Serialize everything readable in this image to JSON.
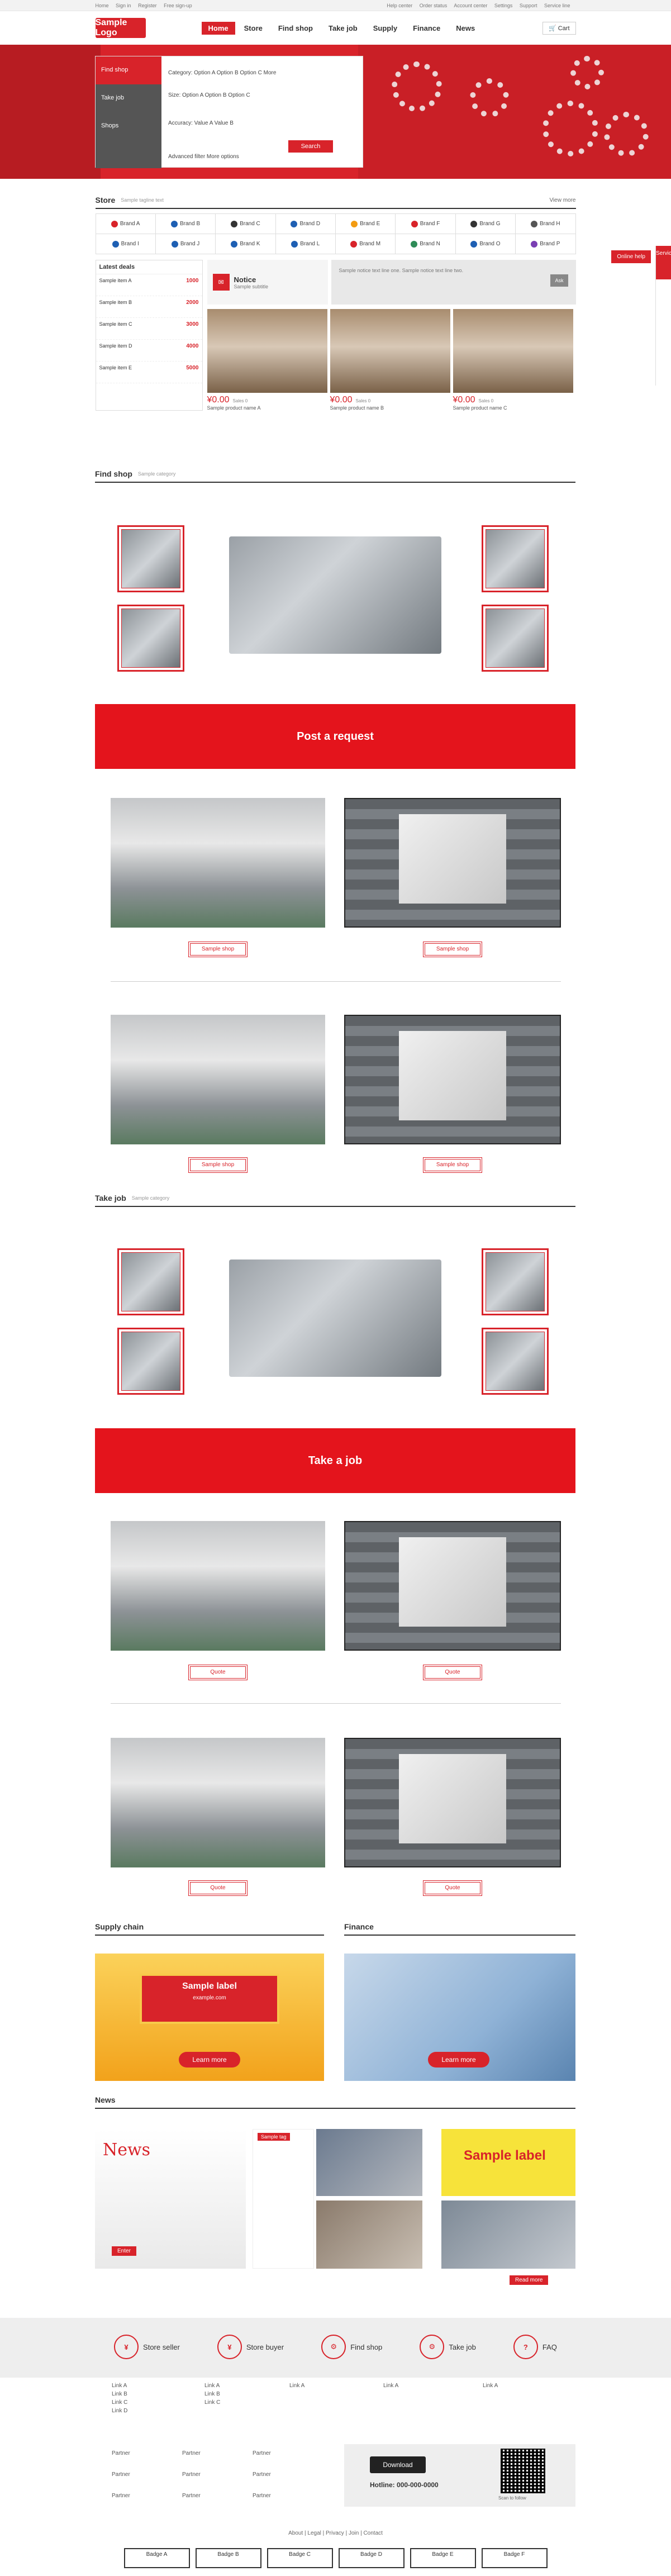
{
  "topbar": {
    "left": [
      "Home",
      "Sign in",
      "Register",
      "Free sign-up"
    ],
    "right": [
      "Help center",
      "Order status",
      "Account center",
      "Settings",
      "Support",
      "Service line"
    ]
  },
  "header": {
    "logo": "Sample Logo",
    "nav": [
      "Home",
      "Store",
      "Find shop",
      "Take job",
      "Supply",
      "Finance",
      "News"
    ],
    "cart": "Cart"
  },
  "search": {
    "tabs": [
      "Find shop",
      "Take job",
      "Shops"
    ],
    "row1": "Category: Option A   Option B   Option C   More",
    "row2": "Size: Option A   Option B   Option C",
    "row3": "Accuracy: Value A   Value B",
    "row4": "Advanced filter      More options",
    "button": "Search"
  },
  "mall": {
    "title": "Store",
    "tagline": "Sample tagline text",
    "more": "View more",
    "brands": [
      "Brand A",
      "Brand B",
      "Brand C",
      "Brand D",
      "Brand E",
      "Brand F",
      "Brand G",
      "Brand H",
      "Brand I",
      "Brand J",
      "Brand K",
      "Brand L",
      "Brand M",
      "Brand N",
      "Brand O",
      "Brand P"
    ],
    "list_title": "Latest deals",
    "list": [
      {
        "name": "Sample item A",
        "price": "1000"
      },
      {
        "name": "Sample item B",
        "price": "2000"
      },
      {
        "name": "Sample item C",
        "price": "3000"
      },
      {
        "name": "Sample item D",
        "price": "4000"
      },
      {
        "name": "Sample item E",
        "price": "5000"
      }
    ],
    "notice_badge": "Notice",
    "notice_sub": "Sample subtitle",
    "notice_text": "Sample notice text line one. Sample notice text line two.",
    "notice_btn": "Ask",
    "products": [
      {
        "price": "¥0.00",
        "sold": "Sales 0",
        "name": "Sample product name A"
      },
      {
        "price": "¥0.00",
        "sold": "Sales 0",
        "name": "Sample product name B"
      },
      {
        "price": "¥0.00",
        "sold": "Sales 0",
        "name": "Sample product name C"
      }
    ]
  },
  "find": {
    "title": "Find shop",
    "sub": "Sample category",
    "bar": "Post a request",
    "button": "Sample shop"
  },
  "take": {
    "title": "Take job",
    "sub": "Sample category",
    "bar": "Take a job",
    "button": "Quote"
  },
  "supply": {
    "title": "Supply chain",
    "label": "Sample label",
    "domain": "example.com",
    "cta": "Learn more"
  },
  "finance": {
    "title": "Finance",
    "cta": "Learn more"
  },
  "news": {
    "title": "News",
    "headline": "News",
    "enter": "Enter",
    "tag": "Sample tag",
    "order": "Sample label",
    "more": "Read more"
  },
  "features": [
    "Store seller",
    "Store buyer",
    "Find shop",
    "Take job",
    "FAQ"
  ],
  "feature_icons": [
    "¥",
    "¥",
    "⚙",
    "⚙",
    "?"
  ],
  "links": {
    "col1": [
      "Link A",
      "Link B",
      "Link C",
      "Link D"
    ],
    "col2": [
      "Link A",
      "Link B",
      "Link C"
    ],
    "col3": [
      "Link A"
    ],
    "col4": [
      "Link A"
    ],
    "col5": [
      "Link A"
    ],
    "partners": [
      "Partner",
      "Partner",
      "Partner",
      "Partner",
      "Partner",
      "Partner",
      "Partner",
      "Partner",
      "Partner"
    ],
    "download": "Download",
    "hotline": "Hotline: 000-000-0000",
    "qr_caption": "Scan to follow"
  },
  "footer_links": "About | Legal | Privacy | Join | Contact",
  "side": {
    "float": "Online help",
    "bar_top": "Service"
  },
  "badges": [
    "Badge A",
    "Badge B",
    "Badge C",
    "Badge D",
    "Badge E",
    "Badge F"
  ],
  "colors": {
    "brand": "#d8232a",
    "bar": "#e4141c"
  }
}
